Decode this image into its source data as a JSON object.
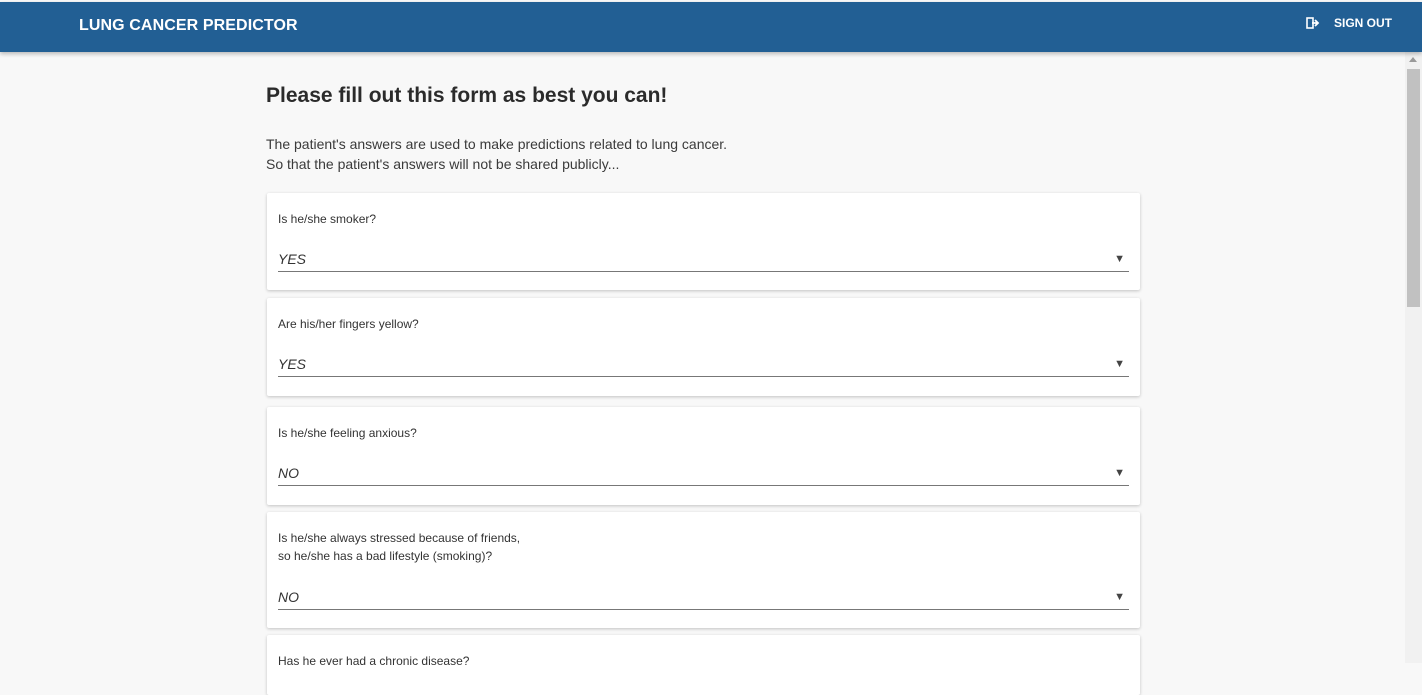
{
  "header": {
    "brand": "LUNG CANCER PREDICTOR",
    "signout_label": "SIGN OUT",
    "color": "#225f94"
  },
  "page": {
    "title": "Please fill out this form as best you can!",
    "intro_line1": "The patient's answers are used to make predictions related to lung cancer.",
    "intro_line2": "So that the patient's answers will not be shared publicly..."
  },
  "questions": [
    {
      "label": "Is he/she smoker?",
      "value": "YES"
    },
    {
      "label": "Are his/her fingers yellow?",
      "value": "YES"
    },
    {
      "label": "Is he/she feeling anxious?",
      "value": "NO"
    },
    {
      "label_line1": "Is he/she always stressed because of friends,",
      "label_line2": "so he/she has a bad lifestyle (smoking)?",
      "value": "NO"
    },
    {
      "label": "Has he ever had a chronic disease?"
    }
  ]
}
